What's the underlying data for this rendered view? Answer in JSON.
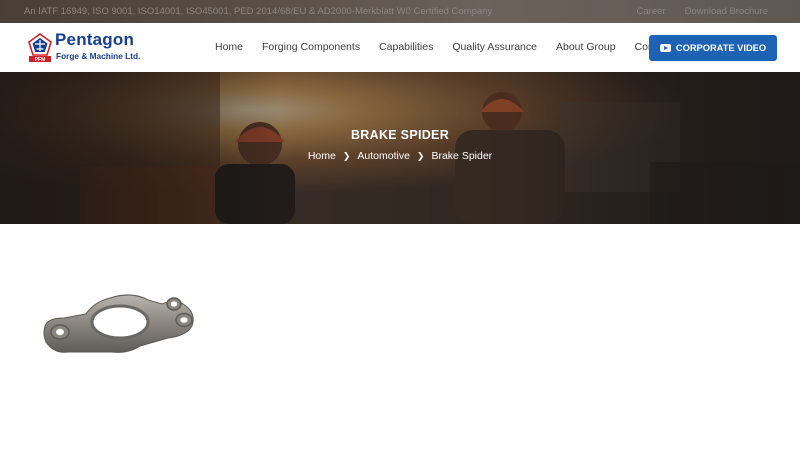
{
  "topbar": {
    "certification": "An IATF 16949, ISO 9001, ISO14001, ISO45001, PED 2014/68/EU & AD2000-Merkblatt W0 Certified Company",
    "links": [
      "Career",
      "Download Brochure"
    ]
  },
  "logo": {
    "name": "Pentagon",
    "subtitle": "Forge & Machine Ltd.",
    "emblem_text": "PFM"
  },
  "nav": {
    "items": [
      "Home",
      "Forging Components",
      "Capabilities",
      "Quality Assurance",
      "About Group",
      "Contact"
    ]
  },
  "cta": {
    "label": "CORPORATE VIDEO",
    "icon": "play-icon"
  },
  "hero": {
    "title": "BRAKE SPIDER",
    "breadcrumb": [
      "Home",
      "Automotive",
      "Brake Spider"
    ],
    "separator_icon": "chevron-right-icon"
  },
  "product": {
    "image": "brake-spider-part"
  },
  "colors": {
    "brand_blue": "#163f93",
    "button_blue": "#1d62b4",
    "logo_red": "#d21f26"
  }
}
